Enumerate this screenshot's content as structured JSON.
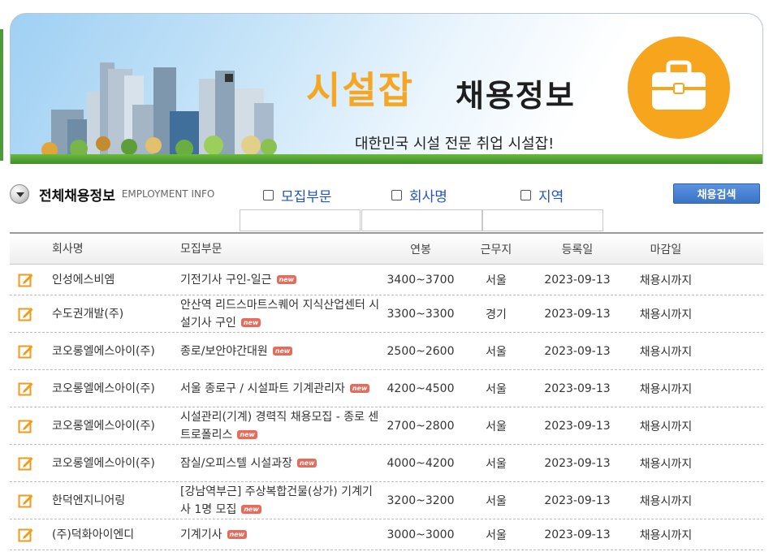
{
  "banner": {
    "brand": "시설잡",
    "title": "채용정보",
    "slogan": "대한민국 시설 전문 취업 시설잡!"
  },
  "search": {
    "section_title": "전체채용정보",
    "section_subtitle": "EMPLOYMENT INFO",
    "filters": [
      "모집부문",
      "회사명",
      "지역"
    ],
    "button_label": "채용검색"
  },
  "table": {
    "headers": [
      "회사명",
      "모집부문",
      "연봉",
      "근무지",
      "등록일",
      "마감일"
    ],
    "new_badge": "new",
    "rows": [
      {
        "company": "인성에스비엠",
        "position": "기전기사 구인-일근",
        "salary": "3400~3700",
        "location": "서울",
        "registered": "2023-09-13",
        "deadline": "채용시까지"
      },
      {
        "company": "수도권개발(주)",
        "position": "안산역 리드스마트스퀘어 지식산업센터 시설기사 구인",
        "salary": "3300~3300",
        "location": "경기",
        "registered": "2023-09-13",
        "deadline": "채용시까지"
      },
      {
        "company": "코오롱엘에스아이(주)",
        "position": "종로/보안야간대원",
        "salary": "2500~2600",
        "location": "서울",
        "registered": "2023-09-13",
        "deadline": "채용시까지"
      },
      {
        "company": "코오롱엘에스아이(주)",
        "position": "서울 종로구 / 시설파트 기계관리자",
        "salary": "4200~4500",
        "location": "서울",
        "registered": "2023-09-13",
        "deadline": "채용시까지"
      },
      {
        "company": "코오롱엘에스아이(주)",
        "position": "시설관리(기계) 경력직 채용모집 - 종로 센트로폴리스",
        "salary": "2700~2800",
        "location": "서울",
        "registered": "2023-09-13",
        "deadline": "채용시까지"
      },
      {
        "company": "코오롱엘에스아이(주)",
        "position": "잠실/오피스텔 시설과장",
        "salary": "4000~4200",
        "location": "서울",
        "registered": "2023-09-13",
        "deadline": "채용시까지"
      },
      {
        "company": "한덕엔지니어링",
        "position": "[강남역부근] 주상복합건물(상가) 기계기사 1명 모집",
        "salary": "3200~3200",
        "location": "서울",
        "registered": "2023-09-13",
        "deadline": "채용시까지"
      },
      {
        "company": "(주)덕화아이엔디",
        "position": "기계기사",
        "salary": "3000~3000",
        "location": "서울",
        "registered": "2023-09-13",
        "deadline": "채용시까지"
      }
    ]
  },
  "colors": {
    "brand_orange": "#f5a623",
    "link_blue": "#2255bb",
    "button_blue": "#3b73c6",
    "badge_red": "#e86a5a"
  },
  "icons": [
    "briefcase-icon",
    "dropdown-circle-icon",
    "checkbox-icon",
    "edit-icon"
  ]
}
